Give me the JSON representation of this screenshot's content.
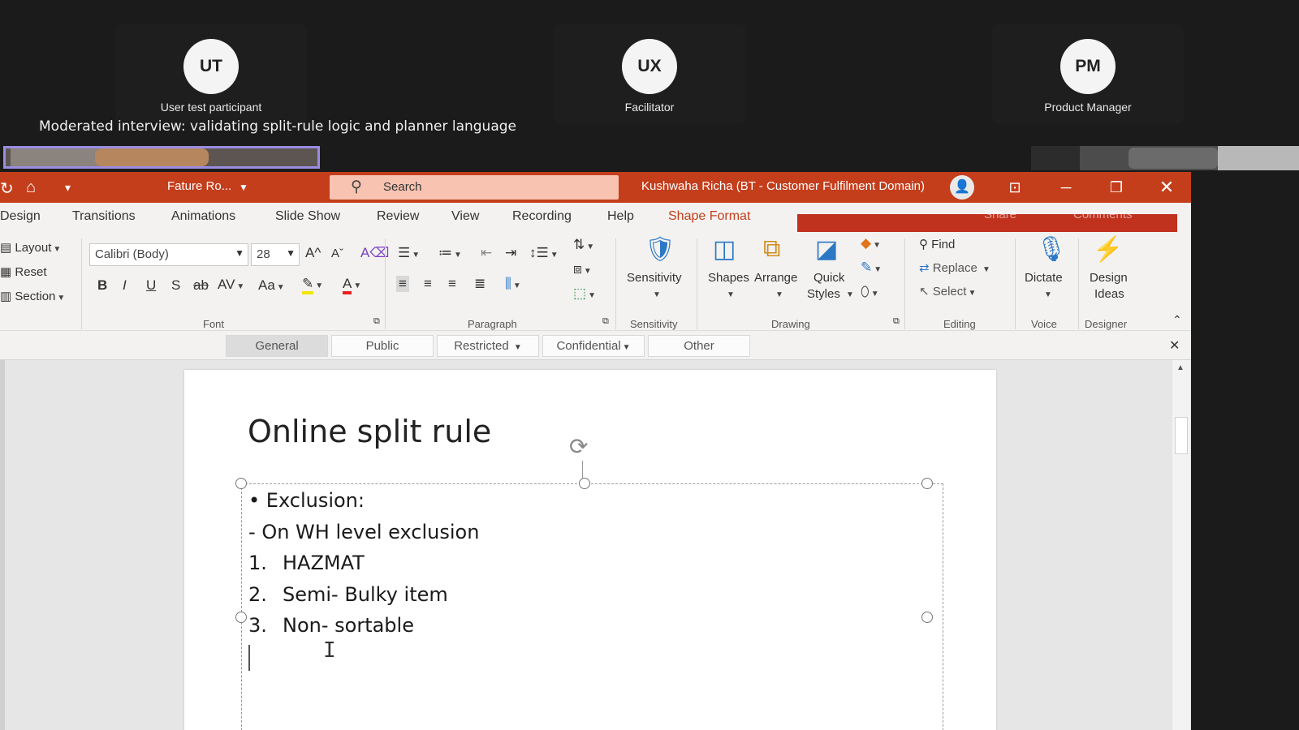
{
  "meeting": {
    "participants": [
      {
        "initials": "UT",
        "role": "User test participant"
      },
      {
        "initials": "UX",
        "role": "Facilitator"
      },
      {
        "initials": "PM",
        "role": "Product Manager"
      }
    ],
    "subtitle": "Moderated interview: validating split-rule logic and planner language"
  },
  "ppt": {
    "filename": "Fature Ro...",
    "search_placeholder": "Search",
    "account": "Kushwaha Richa (BT - Customer Fulfilment Domain)",
    "tabs": [
      "Design",
      "Transitions",
      "Animations",
      "Slide Show",
      "Review",
      "View",
      "Recording",
      "Help",
      "Shape Format"
    ],
    "active_tab": "Shape Format",
    "hidden_buttons": {
      "share": "Share",
      "comments": "Comments"
    },
    "slides_group": {
      "layout": "Layout",
      "reset": "Reset",
      "section": "Section"
    },
    "font": {
      "name": "Calibri (Body)",
      "size": "28",
      "group_label": "Font"
    },
    "groups": {
      "paragraph": "Paragraph",
      "sensitivity": "Sensitivity",
      "drawing": "Drawing",
      "editing": "Editing",
      "voice": "Voice",
      "designer": "Designer"
    },
    "buttons": {
      "sensitivity": "Sensitivity",
      "shapes": "Shapes",
      "arrange": "Arrange",
      "quick_styles_1": "Quick",
      "quick_styles_2": "Styles",
      "find": "Find",
      "replace": "Replace",
      "select": "Select",
      "dictate": "Dictate",
      "design_ideas_1": "Design",
      "design_ideas_2": "Ideas"
    },
    "format_buttons": {
      "bold": "B",
      "italic": "I",
      "underline": "U",
      "shadow": "S",
      "strike": "ab",
      "spacing": "AV",
      "case": "Aa"
    },
    "sensitivity_labels": [
      "General",
      "Public",
      "Restricted",
      "Confidential",
      "Other"
    ],
    "selected_label": "General",
    "slide": {
      "title": "Online split rule",
      "lines": [
        {
          "marker": "•",
          "text": "Exclusion:"
        },
        {
          "marker": "-",
          "text": "On WH level exclusion"
        },
        {
          "marker": "1.",
          "text": "HAZMAT"
        },
        {
          "marker": "2.",
          "text": "Semi- Bulky item"
        },
        {
          "marker": "3.",
          "text": "Non- sortable"
        }
      ]
    }
  },
  "colors": {
    "accent": "#c43e1c",
    "search_bg": "#f8c3b1",
    "meeting_bg": "#1b1b1b",
    "highlight_purple": "#9a8ce0"
  }
}
